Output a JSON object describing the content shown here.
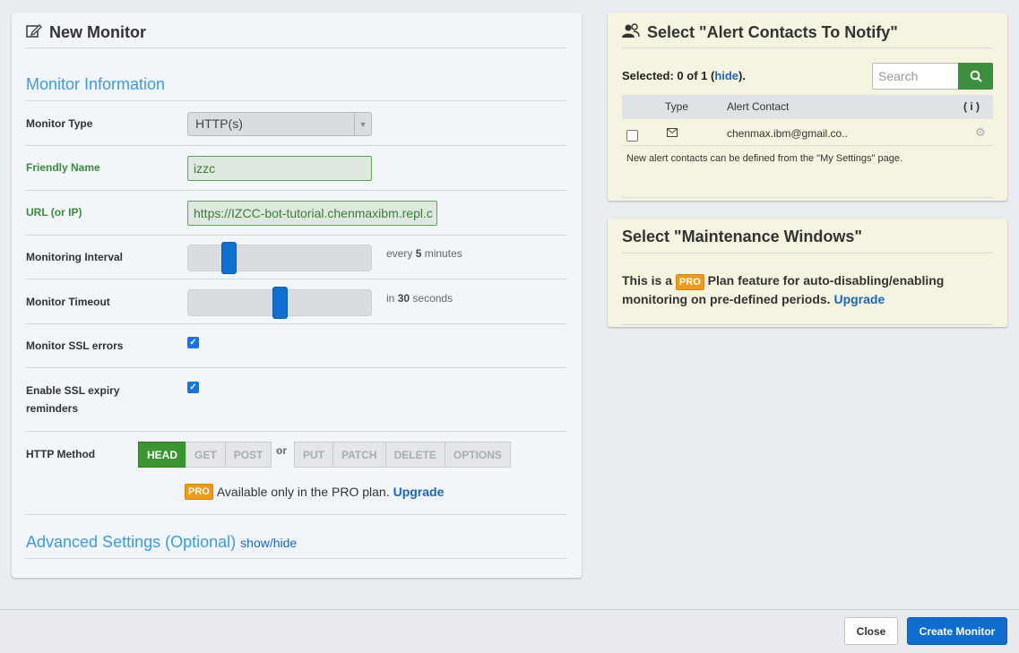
{
  "left": {
    "title": "New Monitor",
    "section_title": "Monitor Information",
    "monitor_type": {
      "label": "Monitor Type",
      "value": "HTTP(s)"
    },
    "friendly_name": {
      "label": "Friendly Name",
      "value": "izzc"
    },
    "url": {
      "label": "URL (or IP)",
      "value": "https://IZCC-bot-tutorial.chenmaxibm.repl.c"
    },
    "interval": {
      "label": "Monitoring Interval",
      "prefix": "every",
      "value": "5",
      "unit": "minutes",
      "position": 0.2
    },
    "timeout": {
      "label": "Monitor Timeout",
      "prefix": "in",
      "value": "30",
      "unit": "seconds",
      "position": 0.5
    },
    "ssl_errors": {
      "label": "Monitor SSL errors",
      "checked": true
    },
    "ssl_expiry": {
      "label_line1": "Enable SSL expiry",
      "label_line2": "reminders",
      "checked": true
    },
    "http_method": {
      "label": "HTTP Method",
      "group1": [
        "HEAD",
        "GET",
        "POST"
      ],
      "or": "or",
      "group2": [
        "PUT",
        "PATCH",
        "DELETE",
        "OPTIONS"
      ],
      "selected": "HEAD"
    },
    "pro_note": {
      "badge": "PRO",
      "text": "Available only in the PRO plan.",
      "link": "Upgrade"
    },
    "advanced": {
      "title": "Advanced Settings (Optional)",
      "toggle": "show/hide"
    }
  },
  "alert_contacts": {
    "title": "Select \"Alert Contacts To Notify\"",
    "selected_prefix": "Selected: 0 of 1 (",
    "hide_link": "hide",
    "selected_suffix": ").",
    "search_placeholder": "Search",
    "columns": {
      "type": "Type",
      "contact": "Alert Contact",
      "info": "( i )"
    },
    "rows": [
      {
        "contact": "chenmax.ibm@gmail.co..",
        "checked": false
      }
    ],
    "note": "New alert contacts can be defined from the \"My Settings\" page."
  },
  "maintenance": {
    "title": "Select \"Maintenance Windows\"",
    "text_before": "This is a",
    "badge": "PRO",
    "text_after": "Plan feature for auto-disabling/enabling monitoring on pre-defined periods.",
    "link": "Upgrade"
  },
  "footer": {
    "close": "Close",
    "create": "Create Monitor"
  },
  "colors": {
    "accent": "#3d9ae8",
    "green": "#3d9433",
    "blue": "#0f6dcf",
    "pro": "#f09a1a"
  }
}
